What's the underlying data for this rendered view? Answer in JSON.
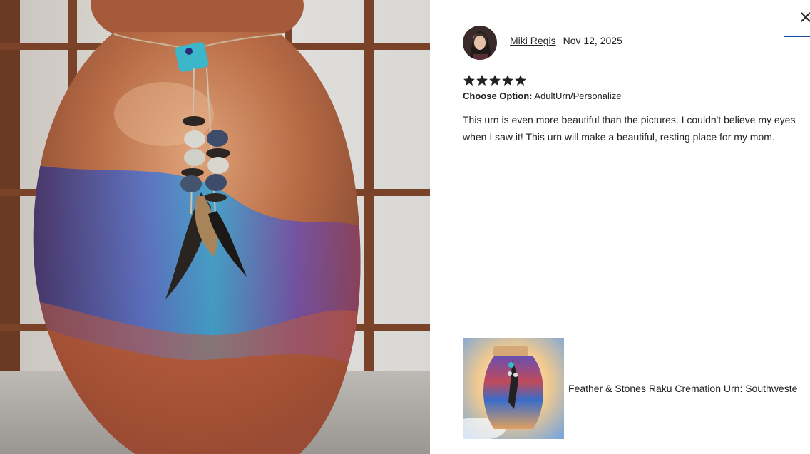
{
  "review": {
    "reviewer_name": "Miki Regis",
    "date": "Nov 12, 2025",
    "rating": 5,
    "option_label": "Choose Option:",
    "option_value": "AdultUrn/Personalize",
    "text": "This urn is even more beautiful than the pictures. I couldn't believe my eyes when I saw it! This urn will make a beautiful, resting place for my mom."
  },
  "product": {
    "title": "Feather & Stones Raku Cremation Urn: Southweste"
  },
  "icons": {
    "close": "close-icon",
    "star": "star-icon"
  },
  "colors": {
    "close_border": "#1b4fa0",
    "star": "#222222",
    "text": "#222222"
  }
}
